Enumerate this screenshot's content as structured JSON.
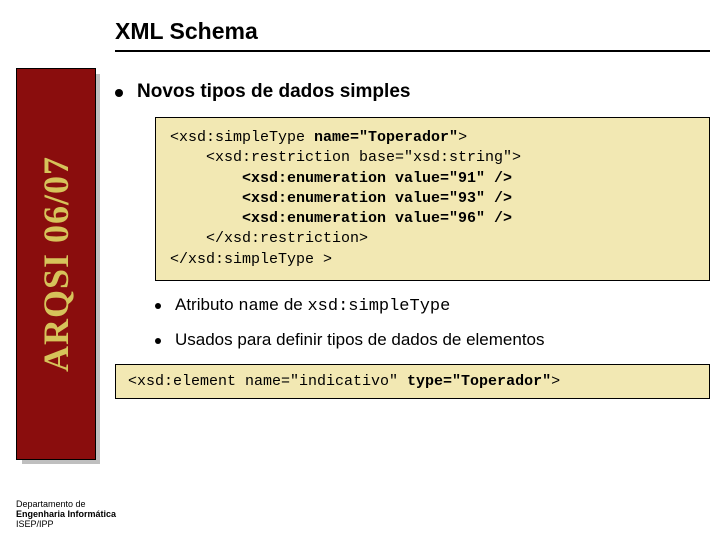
{
  "title": "XML Schema",
  "banner": "ARQSI 06/07",
  "bullets": {
    "main": "Novos tipos de dados simples",
    "sub1_a": "Atributo ",
    "sub1_code1": "name",
    "sub1_b": " de ",
    "sub1_code2": "xsd:simpleType",
    "sub2": "Usados para definir tipos de dados de elementos"
  },
  "code1": {
    "l1a": "<xsd:simpleType ",
    "l1b": "name=\"Toperador\"",
    "l1c": ">",
    "l2": "    <xsd:restriction base=\"xsd:string\">",
    "l3a": "        ",
    "l3b": "<xsd:enumeration value=\"91\" />",
    "l4a": "        ",
    "l4b": "<xsd:enumeration value=\"93\" />",
    "l5a": "        ",
    "l5b": "<xsd:enumeration value=\"96\" />",
    "l6": "    </xsd:restriction>",
    "l7": "</xsd:simpleType >"
  },
  "code2": {
    "a": "<xsd:element name=\"indicativo\" ",
    "b": "type=\"Toperador\"",
    "c": ">"
  },
  "footer": {
    "l1": "Departamento de",
    "l2": "Engenharia Informática",
    "l3": "ISEP/IPP"
  }
}
